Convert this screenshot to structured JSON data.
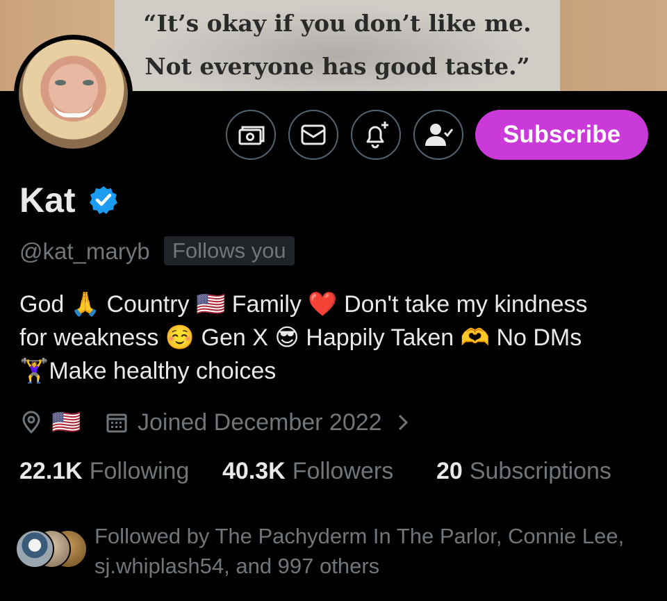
{
  "banner": {
    "quote_line1": "“It’s okay if you don’t like me.",
    "quote_line2": "Not everyone has good taste.”"
  },
  "actions": {
    "tip_icon": "money-icon",
    "message_icon": "envelope-icon",
    "notify_icon": "bell-plus-icon",
    "following_icon": "person-check-icon",
    "subscribe_label": "Subscribe"
  },
  "profile": {
    "name": "Kat",
    "handle": "@kat_maryb",
    "follows_you": "Follows you",
    "bio_line1": "God 🙏 Country 🇺🇸 Family ❤️ Don't take my kindness",
    "bio_line2": "for weakness ☺️ Gen X 😎  Happily Taken 🫶  No DMs",
    "bio_line3": "🏋️‍♀️Make healthy choices",
    "location_flag": "🇺🇸",
    "joined": "Joined December 2022"
  },
  "stats": {
    "following_count": "22.1K",
    "following_label": "Following",
    "followers_count": "40.3K",
    "followers_label": "Followers",
    "subscriptions_count": "20",
    "subscriptions_label": "Subscriptions"
  },
  "followed_by": {
    "line1": "Followed by The Pachyderm In The Parlor, Connie Lee,",
    "line2": "sj.whiplash54, and 997 others"
  },
  "colors": {
    "accent_subscribe": "#c93ad9",
    "verified_blue": "#1d9bf0",
    "muted_text": "#71767b",
    "primary_text": "#e7e9ea"
  }
}
